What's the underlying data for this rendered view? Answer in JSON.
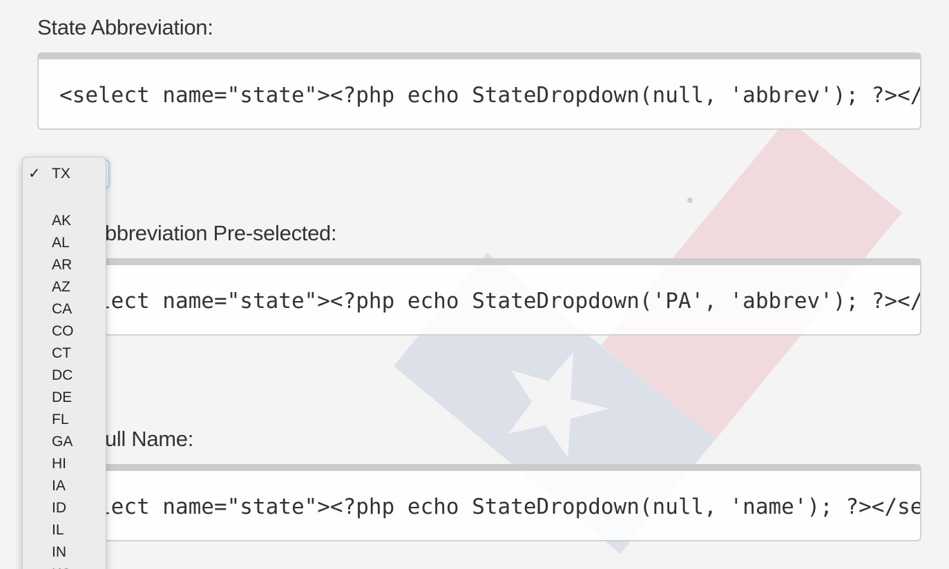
{
  "sections": [
    {
      "label": "State Abbreviation:",
      "code": "<select name=\"state\"><?php echo StateDropdown(null, 'abbrev'); ?></select>"
    },
    {
      "label": "State Abbreviation Pre-selected:",
      "code": "<select name=\"state\"><?php echo StateDropdown('PA', 'abbrev'); ?></select>"
    },
    {
      "label": "State Full Name:",
      "code": "<select name=\"state\"><?php echo StateDropdown(null, 'name'); ?></select>"
    }
  ],
  "dropdown": {
    "check_glyph": "✓",
    "selected": "TX",
    "options": [
      "AK",
      "AL",
      "AR",
      "AZ",
      "CA",
      "CO",
      "CT",
      "DC",
      "DE",
      "FL",
      "GA",
      "HI",
      "IA",
      "ID",
      "IL",
      "IN",
      "KS"
    ]
  },
  "colors": {
    "watermark_blue": "#d9dee8",
    "watermark_red": "#f1d7dc"
  }
}
